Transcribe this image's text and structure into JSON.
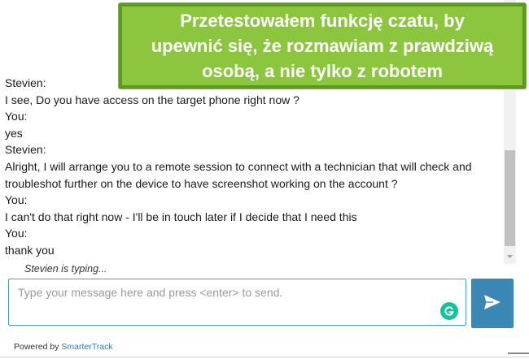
{
  "callout": {
    "text": "Przetestowałem funkcję czatu, by\nupewnić się, że rozmawiam z prawdziwą\nosobą, a nie tylko z robotem",
    "background_color": "#8cc63e",
    "border_color": "#5a9a1c"
  },
  "transcript": {
    "messages": [
      {
        "sender": "Stevien:",
        "text": "I see, Do you have access on the target phone right now ?"
      },
      {
        "sender": "You:",
        "text": "yes"
      },
      {
        "sender": "Stevien:",
        "text_lines": [
          "Alright, I will arrange you to a remote session to connect with a technician that will check and",
          "troubleshot further on the device to have screenshot working on the account ?"
        ]
      },
      {
        "sender": "You:",
        "text": "I can't do that right now - I'll be in touch later if I decide that I need this"
      },
      {
        "sender": "You:",
        "text": "thank you"
      }
    ]
  },
  "typing_indicator": "Stevien is typing...",
  "composer": {
    "placeholder": "Type your message here and press <enter> to send.",
    "value": "",
    "grammarly_icon": "grammarly-icon"
  },
  "send_button": {
    "icon": "send-arrow-icon",
    "color": "#3a87b5"
  },
  "footer": {
    "prefix": "Powered by ",
    "brand": "SmarterTrack"
  }
}
